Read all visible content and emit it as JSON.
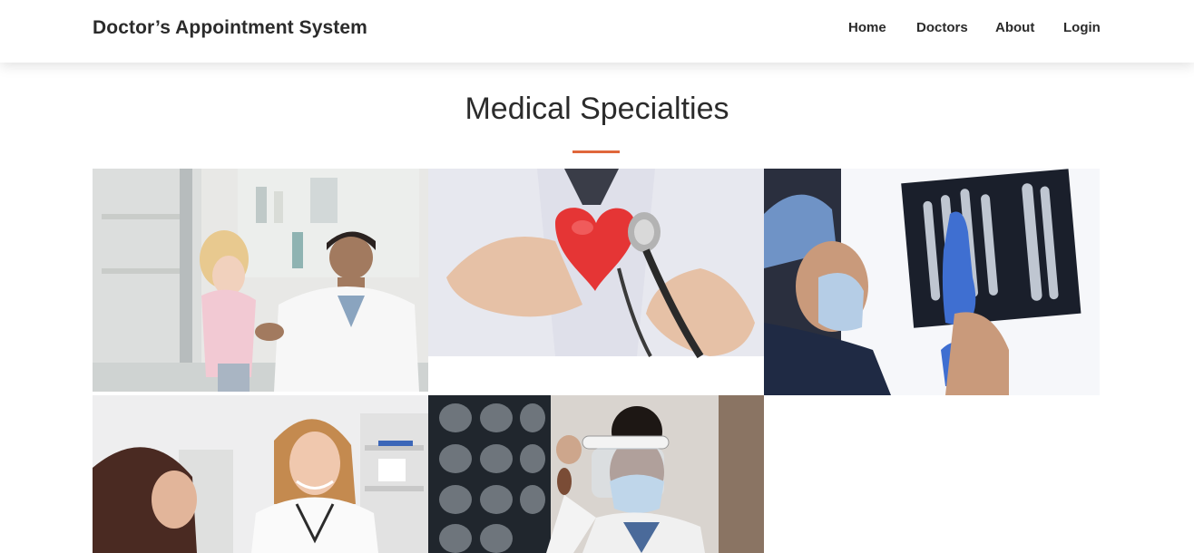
{
  "navbar": {
    "brand": "Doctor’s Appointment System",
    "links": [
      {
        "label": "Home",
        "icon": "none"
      },
      {
        "label": "Doctors",
        "icon": "none"
      },
      {
        "label": "About",
        "icon": "none"
      },
      {
        "label": "Login",
        "icon": "none"
      }
    ]
  },
  "main": {
    "title": "Medical Specialties"
  },
  "colors": {
    "accent": "#e0673b",
    "nav_text": "#2b2b2b",
    "background": "#ffffff"
  }
}
